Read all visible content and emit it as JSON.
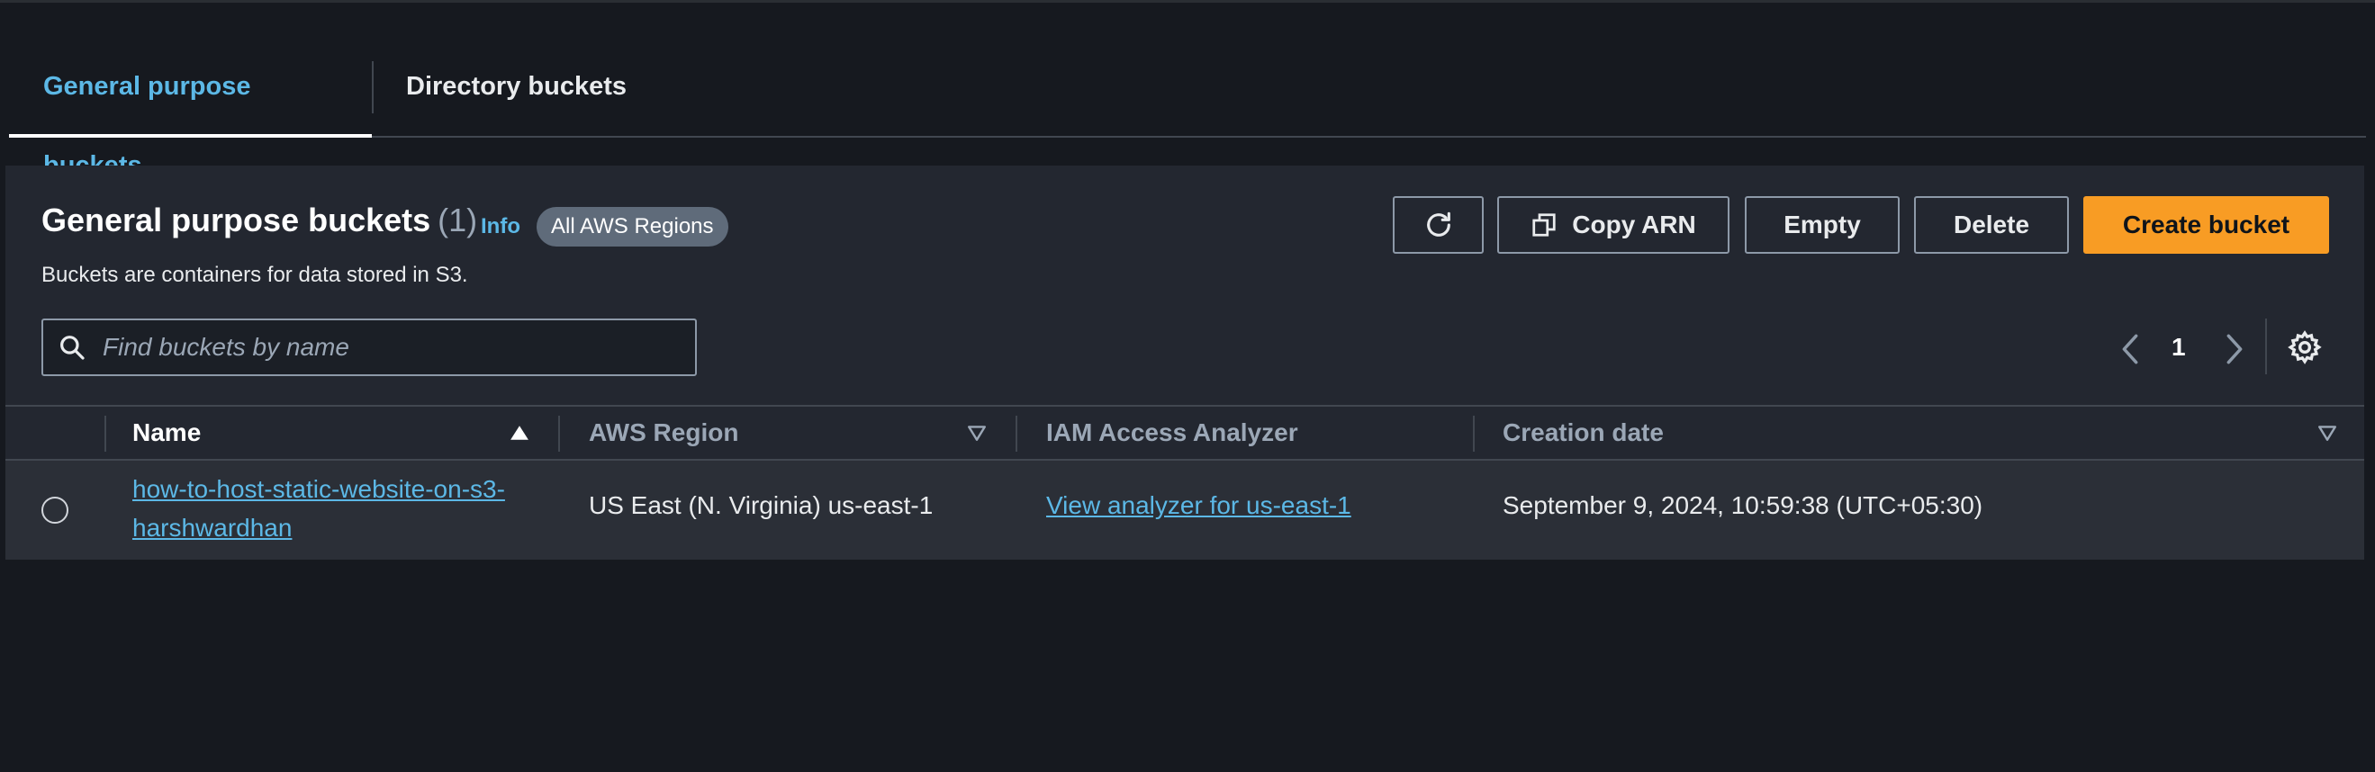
{
  "tabs": [
    {
      "label": "General purpose buckets",
      "active": true
    },
    {
      "label": "Directory buckets",
      "active": false
    }
  ],
  "panel": {
    "title": "General purpose buckets",
    "count": "(1)",
    "info": "Info",
    "regions_badge": "All AWS Regions",
    "description": "Buckets are containers for data stored in S3."
  },
  "toolbar": {
    "refresh_icon": "refresh-icon",
    "copy_arn_label": "Copy ARN",
    "empty_label": "Empty",
    "delete_label": "Delete",
    "create_label": "Create bucket"
  },
  "search": {
    "placeholder": "Find buckets by name",
    "value": ""
  },
  "pagination": {
    "current_page": "1"
  },
  "table": {
    "columns": [
      {
        "label": "Name",
        "sort": "ascending"
      },
      {
        "label": "AWS Region",
        "sort": "none"
      },
      {
        "label": "IAM Access Analyzer",
        "sort": "none"
      },
      {
        "label": "Creation date",
        "sort": "none"
      }
    ],
    "rows": [
      {
        "name": "how-to-host-static-website-on-s3-harshwardhan",
        "region": "US East (N. Virginia) us-east-1",
        "iam_access_analyzer": "View analyzer for us-east-1",
        "creation_date": "September 9, 2024, 10:59:38 (UTC+05:30)",
        "selected": false
      }
    ]
  },
  "colors": {
    "background": "#16191f",
    "panel": "#232730",
    "row": "#2b2f37",
    "link": "#5cb8e6",
    "primary_button": "#f89c24",
    "border": "#8d99a8"
  }
}
